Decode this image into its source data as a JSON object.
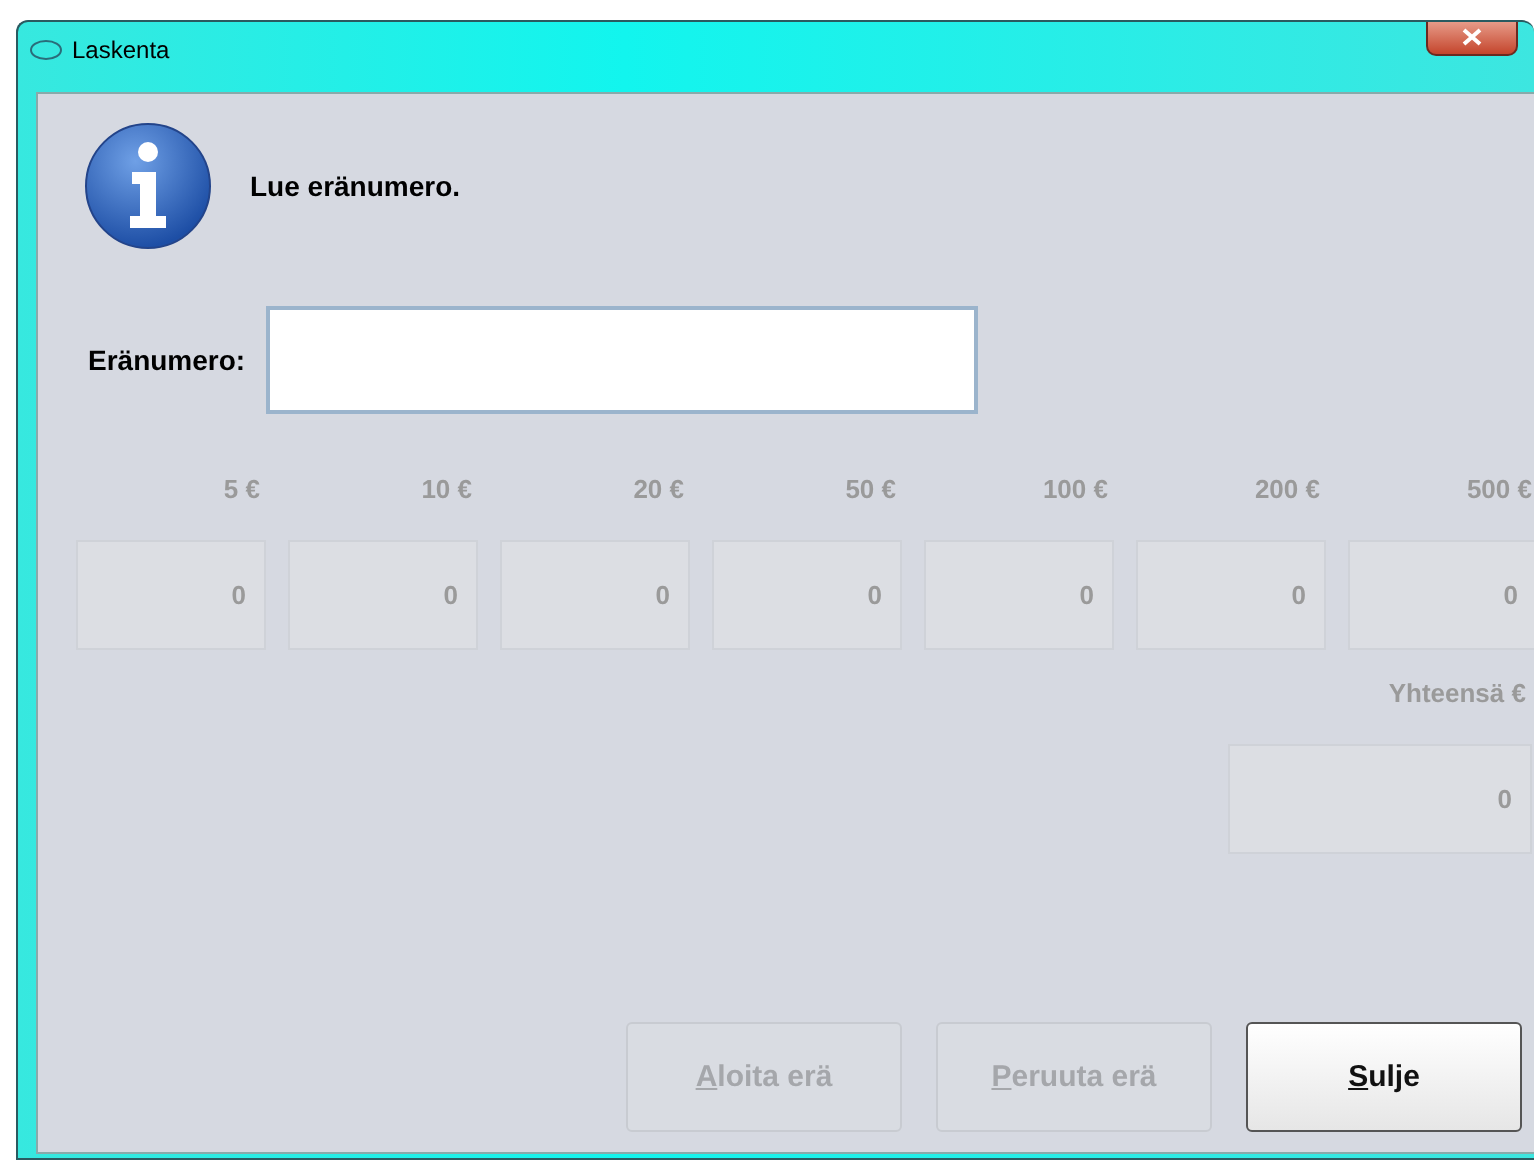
{
  "window": {
    "title": "Laskenta"
  },
  "message": "Lue eränumero.",
  "batch_field": {
    "label": "Eränumero:",
    "focused": true
  },
  "denominations": [
    {
      "label": "5 €",
      "value": "0",
      "disabled": true
    },
    {
      "label": "10 €",
      "value": "0",
      "disabled": true
    },
    {
      "label": "20 €",
      "value": "0",
      "disabled": true
    },
    {
      "label": "50 €",
      "value": "0",
      "disabled": true
    },
    {
      "label": "100 €",
      "value": "0",
      "disabled": true
    },
    {
      "label": "200 €",
      "value": "0",
      "disabled": true
    },
    {
      "label": "500 €",
      "value": "0",
      "disabled": true
    }
  ],
  "total": {
    "label": "Yhteensä €",
    "value": "0",
    "disabled": true
  },
  "buttons": [
    {
      "mnemonic": "A",
      "rest": "loita erä",
      "disabled": true
    },
    {
      "mnemonic": "P",
      "rest": "eruuta erä",
      "disabled": true
    },
    {
      "mnemonic": "S",
      "rest": "ulje",
      "disabled": false
    }
  ]
}
